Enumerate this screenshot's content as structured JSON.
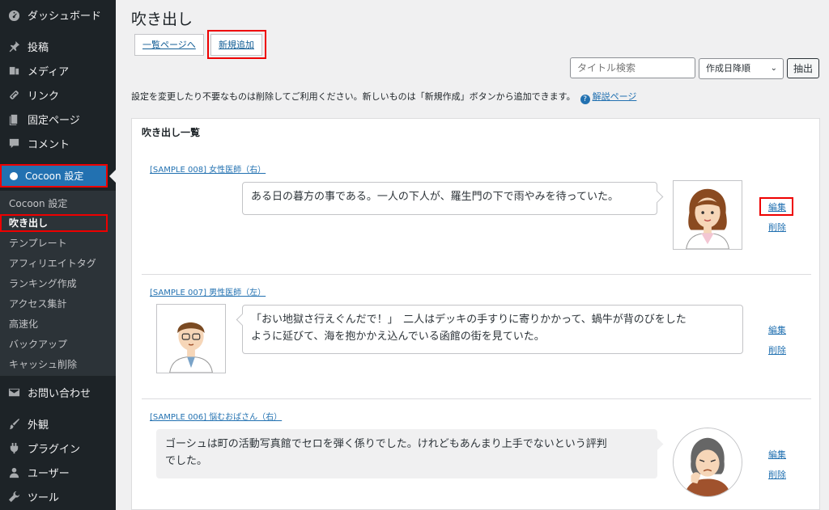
{
  "sidebar": {
    "items": [
      {
        "label": "ダッシュボード",
        "icon": "dashboard-icon"
      },
      {
        "label": "投稿",
        "icon": "pushpin-icon"
      },
      {
        "label": "メディア",
        "icon": "media-icon"
      },
      {
        "label": "リンク",
        "icon": "link-icon"
      },
      {
        "label": "固定ページ",
        "icon": "page-icon"
      },
      {
        "label": "コメント",
        "icon": "comment-icon"
      }
    ],
    "active": {
      "label": "Cocoon 設定",
      "icon": "cocoon-icon"
    },
    "submenu": [
      "Cocoon 設定",
      "吹き出し",
      "テンプレート",
      "アフィリエイトタグ",
      "ランキング作成",
      "アクセス集計",
      "高速化",
      "バックアップ",
      "キャッシュ削除"
    ],
    "current_submenu_index": 1,
    "bottom_items": [
      {
        "label": "お問い合わせ",
        "icon": "mail-icon"
      },
      {
        "label": "外観",
        "icon": "brush-icon"
      },
      {
        "label": "プラグイン",
        "icon": "plugin-icon"
      },
      {
        "label": "ユーザー",
        "icon": "user-icon"
      },
      {
        "label": "ツール",
        "icon": "wrench-icon"
      }
    ]
  },
  "page": {
    "title": "吹き出し",
    "list_link": "一覧ページへ",
    "new_link": "新規追加",
    "search_placeholder": "タイトル検索",
    "sort_selected": "作成日降順",
    "filter_button": "抽出",
    "description": "設定を変更したり不要なものは削除してご利用ください。新しいものは「新規作成」ボタンから追加できます。",
    "help_link": "解説ページ",
    "panel_title": "吹き出し一覧"
  },
  "entries": [
    {
      "title": "[SAMPLE 008] 女性医師（右）",
      "text_lines": [
        "ある日の暮方の事である。一人の下人が、羅生門の下で雨やみを待っていた。"
      ],
      "avatar": "female-doctor-avatar",
      "edit": "編集",
      "delete": "削除"
    },
    {
      "title": "[SAMPLE 007] 男性医師（左）",
      "text_lines": [
        "「おい地獄さ行えぐんだで！」　二人はデッキの手すりに寄りかかって、蝸牛が背のびをした",
        "ように延びて、海を抱かかえ込んでいる函館の街を見ていた。"
      ],
      "avatar": "male-doctor-avatar",
      "edit": "編集",
      "delete": "削除"
    },
    {
      "title": "[SAMPLE 006] 悩むおばさん（右）",
      "text_lines": [
        "ゴーシュは町の活動写真館でセロを弾く係りでした。けれどもあんまり上手でないという評判",
        "でした。"
      ],
      "avatar": "worried-woman-avatar",
      "edit": "編集",
      "delete": "削除"
    }
  ],
  "colors": {
    "highlight": "#e00",
    "accent": "#2271b1",
    "sidebar": "#1d2327"
  }
}
